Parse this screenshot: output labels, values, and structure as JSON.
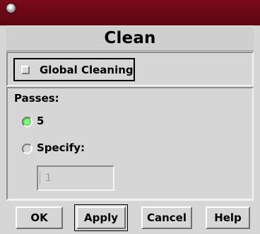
{
  "window": {
    "title": "Clean",
    "menu_icon": "window-menu-icon"
  },
  "global_cleaning": {
    "label": "Global Cleaning",
    "checked": false
  },
  "passes": {
    "label": "Passes:",
    "options": [
      {
        "label": "5",
        "selected": true
      },
      {
        "label": "Specify:",
        "selected": false
      }
    ],
    "specify_value": "1"
  },
  "buttons": {
    "ok": "OK",
    "apply": "Apply",
    "cancel": "Cancel",
    "help": "Help"
  },
  "colors": {
    "titlebar": "#6b0715",
    "radio_selected": "#2fd62f",
    "background": "#d6d6d6"
  }
}
